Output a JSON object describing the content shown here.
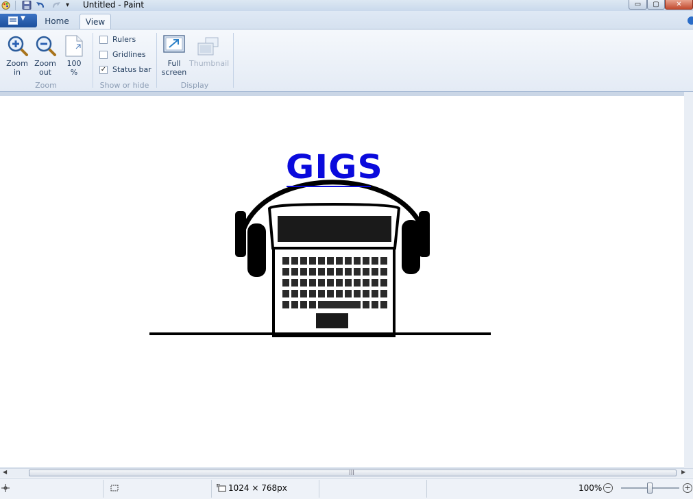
{
  "window": {
    "title": "Untitled - Paint",
    "minimize_glyph": "▭",
    "maximize_glyph": "▢",
    "close_glyph": "✕"
  },
  "qat": {
    "customize_glyph": "▾"
  },
  "tabs": [
    {
      "label": "Home",
      "active": false
    },
    {
      "label": "View",
      "active": true
    }
  ],
  "ribbon": {
    "zoom_group": {
      "label": "Zoom",
      "zoom_in": {
        "line1": "Zoom",
        "line2": "in"
      },
      "zoom_out": {
        "line1": "Zoom",
        "line2": "out"
      },
      "hundred": {
        "line1": "100",
        "line2": "%"
      }
    },
    "show_hide_group": {
      "label": "Show or hide",
      "rulers": {
        "label": "Rulers",
        "checked": false
      },
      "gridlines": {
        "label": "Gridlines",
        "checked": false
      },
      "status_bar": {
        "label": "Status bar",
        "checked": true,
        "mark": "✓"
      }
    },
    "display_group": {
      "label": "Display",
      "full_screen": {
        "line1": "Full",
        "line2": "screen"
      },
      "thumbnail": {
        "label": "Thumbnail"
      }
    }
  },
  "canvas_image": {
    "logo_text": "GIGS",
    "logo_color": "#0a0adc"
  },
  "scrollbar": {
    "grip_glyph": "|||"
  },
  "status": {
    "image_size": "1024 × 768px",
    "zoom_level": "100%",
    "zoom_out_glyph": "−",
    "zoom_in_glyph": "+"
  },
  "colors": {
    "accent": "#1c4f9c",
    "workspace": "#cad6e6"
  }
}
